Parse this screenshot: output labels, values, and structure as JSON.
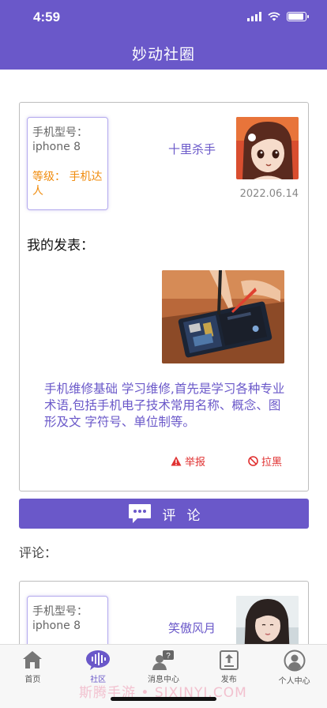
{
  "status_bar": {
    "time": "4:59"
  },
  "nav": {
    "title": "妙动社圈"
  },
  "post": {
    "model_label": "手机型号：",
    "model_value": "iphone 8",
    "level": "等级： 手机达人",
    "username": "十里杀手",
    "date": "2022.06.14",
    "section_title": "我的发表：",
    "text": "手机维修基础 学习维修,首先是学习各种专业术语,包括手机电子技术常用名称、概念、图形及文 字符号、单位制等。",
    "report_label": "举报",
    "block_label": "拉黑"
  },
  "comment_button": {
    "label": "评论"
  },
  "comments_heading": "评论：",
  "comment": {
    "model_label": "手机型号：",
    "model_value": "iphone 8",
    "username": "笑傲风月"
  },
  "tabbar": {
    "items": [
      {
        "label": "首页",
        "icon": "home-icon",
        "active": false
      },
      {
        "label": "社区",
        "icon": "community-icon",
        "active": true
      },
      {
        "label": "消息中心",
        "icon": "message-icon",
        "active": false
      },
      {
        "label": "发布",
        "icon": "publish-icon",
        "active": false
      },
      {
        "label": "个人中心",
        "icon": "profile-icon",
        "active": false
      }
    ]
  },
  "watermark": "斯腾手游 • SIXINYI.COM",
  "colors": {
    "accent": "#6a58c9",
    "level": "#f08c0e",
    "danger": "#e03131"
  }
}
